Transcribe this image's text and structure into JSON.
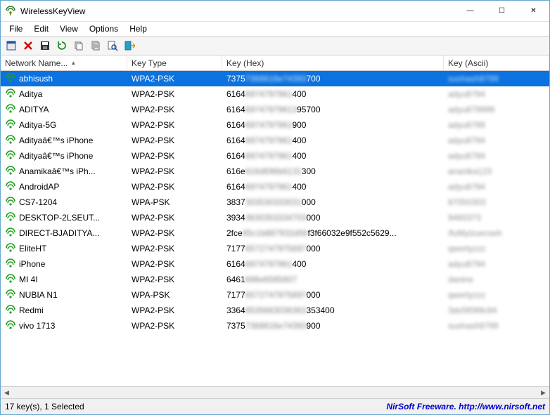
{
  "window": {
    "title": "WirelessKeyView",
    "minimize_glyph": "—",
    "maximize_glyph": "☐",
    "close_glyph": "✕"
  },
  "menu": {
    "file": "File",
    "edit": "Edit",
    "view": "View",
    "options": "Options",
    "help": "Help"
  },
  "toolbar_icons": [
    "properties-icon",
    "delete-icon",
    "save-icon",
    "refresh-icon",
    "copy-icon",
    "copy-text-icon",
    "find-icon",
    "exit-icon"
  ],
  "columns": {
    "name": "Network Name...",
    "name_sort_glyph": "▲",
    "type": "Key Type",
    "hex": "Key (Hex)",
    "ascii": "Key (Ascii)"
  },
  "rows": [
    {
      "name": "abhisush",
      "type": "WPA2-PSK",
      "hex_prefix": "7375",
      "hex_blur": "7368616e74393",
      "hex_suffix": "700",
      "ascii": "sushash8799",
      "selected": true
    },
    {
      "name": "Aditya",
      "type": "WPA2-PSK",
      "hex_prefix": "6164",
      "hex_blur": "6974797961",
      "hex_suffix": "400",
      "ascii": "adyu8794"
    },
    {
      "name": "ADITYA",
      "type": "WPA2-PSK",
      "hex_prefix": "6164",
      "hex_blur": "69747979613",
      "hex_suffix": "95700",
      "ascii": "adyu879999"
    },
    {
      "name": "Aditya-5G",
      "type": "WPA2-PSK",
      "hex_prefix": "6164",
      "hex_blur": "6974797961",
      "hex_suffix": "900",
      "ascii": "adyu8799"
    },
    {
      "name": "Adityaâ€™s iPhone",
      "type": "WPA2-PSK",
      "hex_prefix": "6164",
      "hex_blur": "6974797961",
      "hex_suffix": "400",
      "ascii": "adyu8794"
    },
    {
      "name": "Adityaâ€™s iPhone",
      "type": "WPA2-PSK",
      "hex_prefix": "6164",
      "hex_blur": "6974797961",
      "hex_suffix": "400",
      "ascii": "adyu8794"
    },
    {
      "name": "Anamikaâ€™s iPh...",
      "type": "WPA2-PSK",
      "hex_prefix": "616e",
      "hex_blur": "616d696b6131",
      "hex_suffix": "300",
      "ascii": "ananika123"
    },
    {
      "name": "AndroidAP",
      "type": "WPA2-PSK",
      "hex_prefix": "6164",
      "hex_blur": "6974797961",
      "hex_suffix": "400",
      "ascii": "adyu8794"
    },
    {
      "name": "CS7-1204",
      "type": "WPA-PSK",
      "hex_prefix": "3837",
      "hex_blur": "303530333031",
      "hex_suffix": "000",
      "ascii": "87050303"
    },
    {
      "name": "DESKTOP-2LSEUT...",
      "type": "WPA2-PSK",
      "hex_prefix": "3934",
      "hex_blur": "3630353334703",
      "hex_suffix": "000",
      "ascii": "9460373"
    },
    {
      "name": "DIRECT-BJADITYA...",
      "type": "WPA2-PSK",
      "hex_prefix": "2fce",
      "hex_blur": "85c1b887932d56",
      "hex_suffix": "f3f66032e9f552c5629...",
      "ascii": "/fuMyizuecseh"
    },
    {
      "name": "EliteHT",
      "type": "WPA2-PSK",
      "hex_prefix": "7177",
      "hex_blur": "6572747975697",
      "hex_suffix": "000",
      "ascii": "qwertyzzz"
    },
    {
      "name": "iPhone",
      "type": "WPA2-PSK",
      "hex_prefix": "6164",
      "hex_blur": "6974797961",
      "hex_suffix": "400",
      "ascii": "adyu8794"
    },
    {
      "name": "MI 4I",
      "type": "WPA2-PSK",
      "hex_prefix": "6461",
      "hex_blur": "696e6565607",
      "hex_suffix": "",
      "ascii": "danine"
    },
    {
      "name": "NUBIA N1",
      "type": "WPA-PSK",
      "hex_prefix": "7177",
      "hex_blur": "6572747975697",
      "hex_suffix": "000",
      "ascii": "qwertyzzz"
    },
    {
      "name": "Redmi",
      "type": "WPA2-PSK",
      "hex_prefix": "3364",
      "hex_blur": "6535663036363",
      "hex_suffix": "353400",
      "ascii": "3de5f099c94"
    },
    {
      "name": "vivo 1713",
      "type": "WPA2-PSK",
      "hex_prefix": "7375",
      "hex_blur": "7368616e74393",
      "hex_suffix": "900",
      "ascii": "sushash8799"
    }
  ],
  "status": {
    "left": "17 key(s), 1 Selected",
    "right_prefix": "NirSoft Freeware.  ",
    "right_link": "http://www.nirsoft.net"
  }
}
